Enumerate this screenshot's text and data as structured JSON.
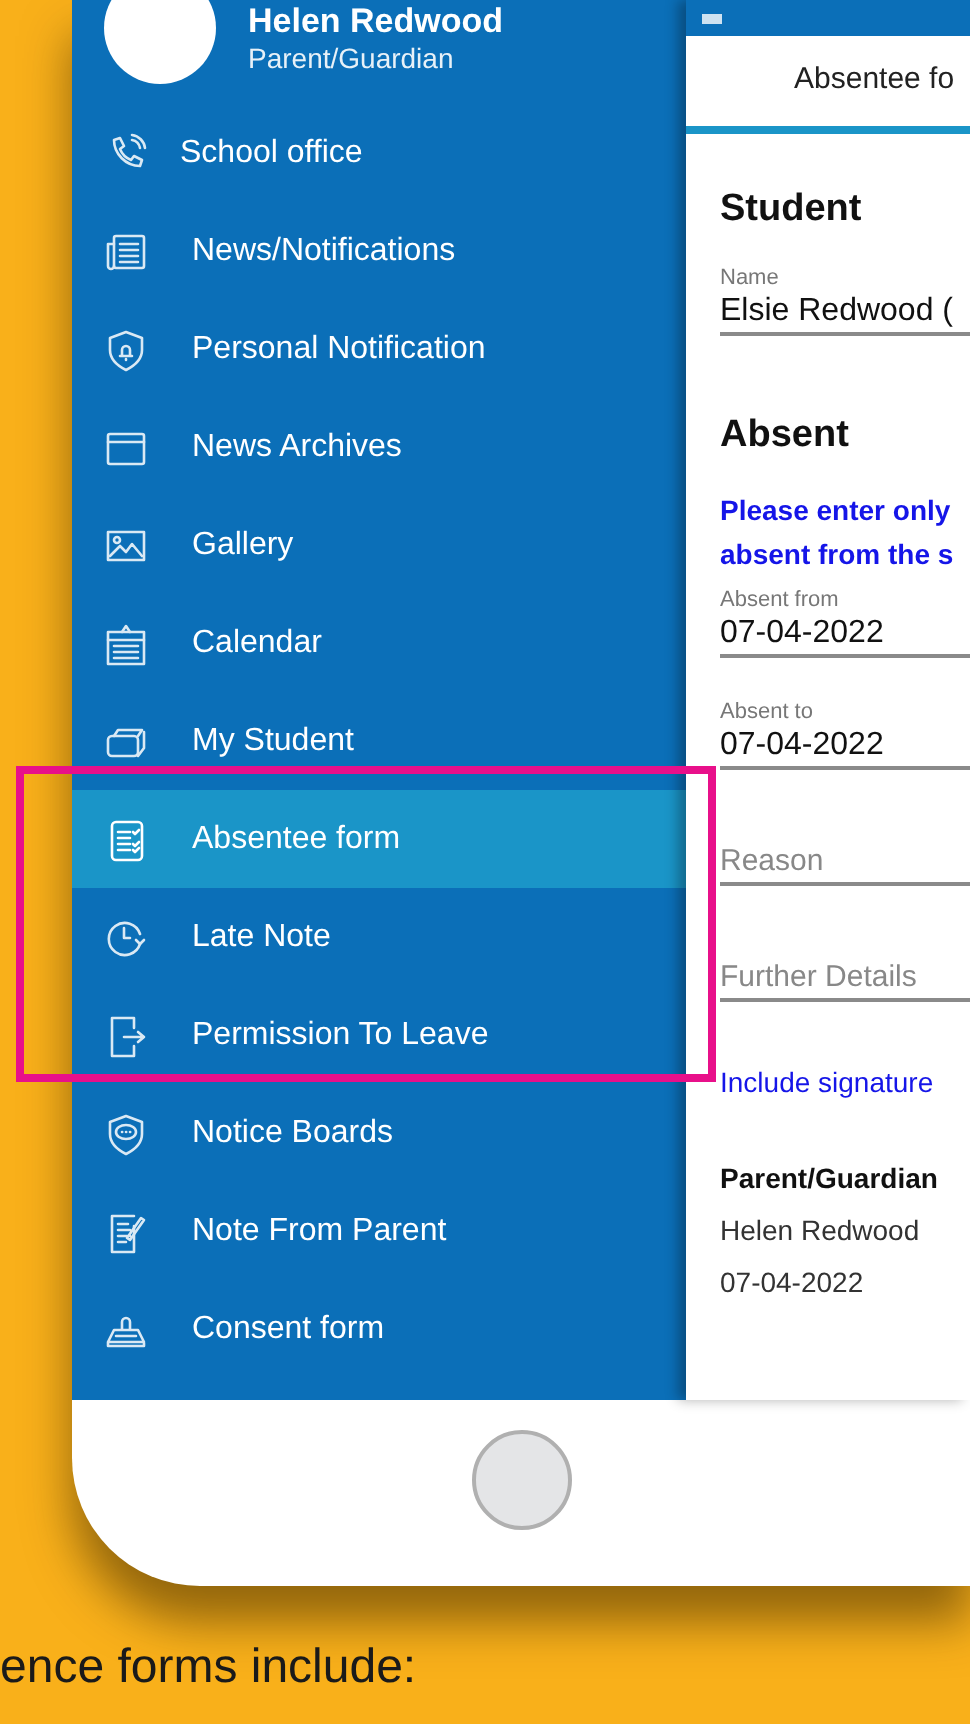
{
  "profile": {
    "name": "Helen Redwood",
    "role": "Parent/Guardian"
  },
  "menu": [
    {
      "label": "School office",
      "selected": false
    },
    {
      "label": "News/Notifications",
      "selected": false
    },
    {
      "label": "Personal Notification",
      "selected": false
    },
    {
      "label": "News Archives",
      "selected": false
    },
    {
      "label": "Gallery",
      "selected": false
    },
    {
      "label": "Calendar",
      "selected": false
    },
    {
      "label": "My Student",
      "selected": false
    },
    {
      "label": "Absentee form",
      "selected": true
    },
    {
      "label": "Late Note",
      "selected": false
    },
    {
      "label": "Permission To Leave",
      "selected": false
    },
    {
      "label": "Notice Boards",
      "selected": false
    },
    {
      "label": "Note From Parent",
      "selected": false
    },
    {
      "label": "Consent form",
      "selected": false
    }
  ],
  "form": {
    "tab": "Absentee fo",
    "student_heading": "Student",
    "name_field": {
      "label": "Name",
      "value": "Elsie Redwood ("
    },
    "absent_heading": "Absent",
    "note_lines": [
      "Please enter only",
      "absent from the s"
    ],
    "fields": [
      {
        "label": "Absent from",
        "value": "07-04-2022"
      },
      {
        "label": "Absent to",
        "value": "07-04-2022"
      },
      {
        "placeholder": "Reason"
      },
      {
        "placeholder": "Further Details"
      }
    ],
    "signature_link": "Include signature",
    "signer": {
      "heading": "Parent/Guardian",
      "name": "Helen Redwood",
      "date": "07-04-2022"
    }
  },
  "caption": "ence forms include:"
}
